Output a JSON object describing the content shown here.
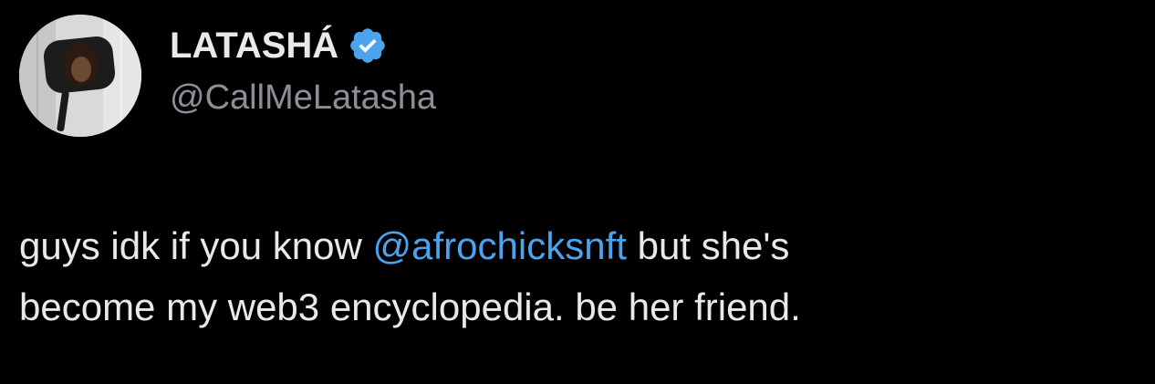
{
  "author": {
    "display_name": "LATASHÁ",
    "handle": "@CallMeLatasha",
    "verified": true,
    "avatar": "profile-photo"
  },
  "tweet": {
    "text_before_mention": "guys idk if you know ",
    "mention": "@afrochicksnft",
    "text_after_mention_line1": " but she's",
    "text_line2": "become my web3 encyclopedia. be her friend."
  },
  "colors": {
    "background": "#000000",
    "text": "#e7e9ea",
    "secondary_text": "#8b9097",
    "link": "#4aa3ec",
    "verified_badge": "#4aa3ec"
  }
}
